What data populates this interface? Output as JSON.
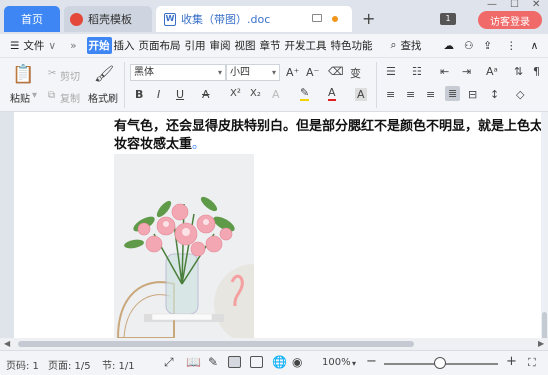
{
  "tabs": {
    "home": "首页",
    "template": "稻壳模板",
    "document": "收集（带图）.doc",
    "new_tab": "+",
    "badge_count": "1",
    "visitor_login": "访客登录"
  },
  "menu": {
    "file": "文件",
    "items": [
      "开始",
      "插入",
      "页面布局",
      "引用",
      "审阅",
      "视图",
      "章节",
      "开发工具",
      "特色功能"
    ],
    "active": "开始",
    "search": "查找"
  },
  "toolbar": {
    "paste": "粘贴",
    "cut": "剪切",
    "copy": "复制",
    "format_painter": "格式刷",
    "font_name": "黑体",
    "font_size": "小四",
    "bold": "B",
    "italic": "I",
    "underline": "U",
    "font_color_a": "A",
    "superscript": "X²",
    "subscript": "X₂",
    "highlight_a": "A",
    "clear_format": "A",
    "char_shade": "A",
    "grow_font": "A⁺",
    "shrink_font": "A⁻",
    "phonetic": "变"
  },
  "document": {
    "line1": "有气色，还会显得皮肤特别白。但是部分腮红不是颜色不明显，就是上色太",
    "line2": "妆容妆感太重",
    "para_mark": "。"
  },
  "status": {
    "page_code": "页码: 1",
    "page": "页面: 1/5",
    "section": "节: 1/1",
    "zoom": "100%",
    "zoom_minus": "−",
    "zoom_plus": "+"
  },
  "zoom_level_percent": 100,
  "colors": {
    "accent": "#3d86f4",
    "visitor": "#f06a6a",
    "unsaved_dot": "#f2951d"
  }
}
